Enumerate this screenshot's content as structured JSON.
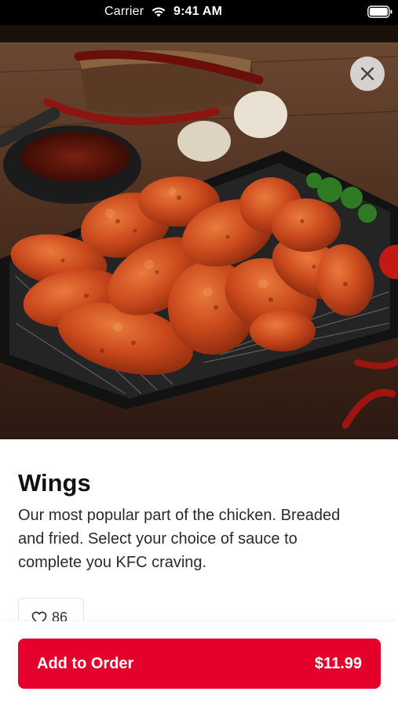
{
  "status_bar": {
    "carrier": "Carrier",
    "time": "9:41 AM"
  },
  "hero": {
    "icon": "close-icon"
  },
  "item": {
    "title": "Wings",
    "description": "Our most popular part of the chicken. Breaded and fried. Select your choice of sauce to complete you KFC craving.",
    "likes": "86"
  },
  "order": {
    "button_label": "Add to Order",
    "price": "$11.99"
  },
  "colors": {
    "accent": "#e4002b"
  }
}
